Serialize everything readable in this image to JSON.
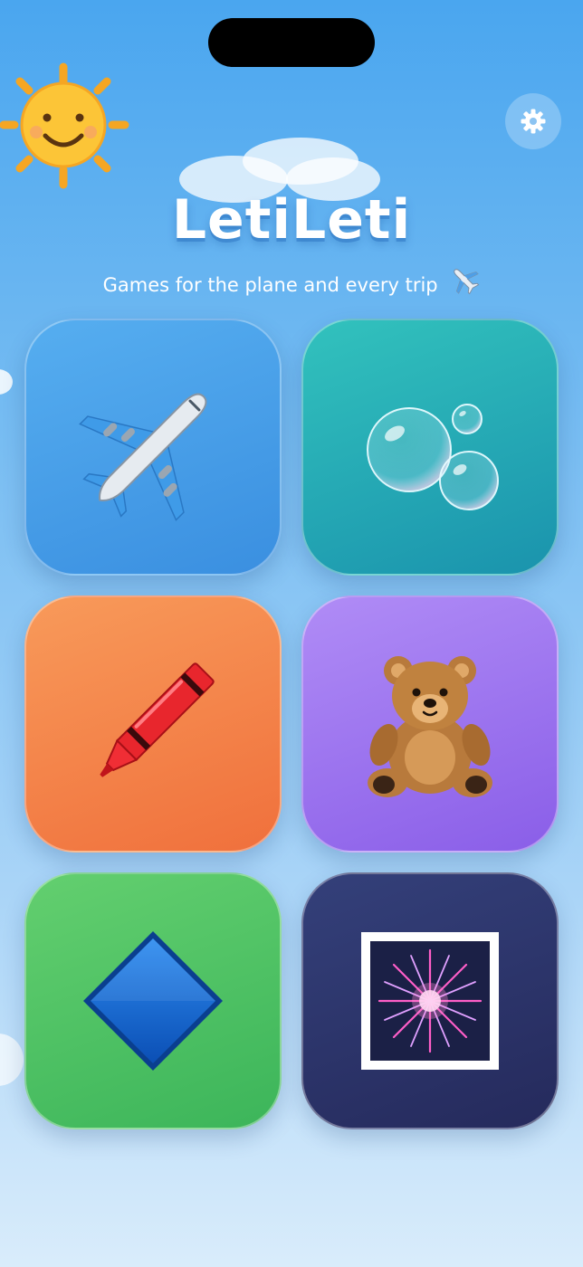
{
  "app": {
    "title": "LetiLeti",
    "subtitle": "Games for the plane and every trip"
  },
  "header": {
    "settings_icon": "gear-icon",
    "sun_icon": "smiling-sun-icon"
  },
  "games": [
    {
      "icon": "airplane-icon",
      "color_top": "#56aef0",
      "color_bottom": "#3a8fe0"
    },
    {
      "icon": "bubbles-icon",
      "color_top": "#32c2bd",
      "color_bottom": "#1a93ad"
    },
    {
      "icon": "crayon-icon",
      "color_top": "#f89a5a",
      "color_bottom": "#f0703c"
    },
    {
      "icon": "teddy-bear-icon",
      "color_top": "#b08cf6",
      "color_bottom": "#8a5ee8"
    },
    {
      "icon": "blue-diamond-icon",
      "color_top": "#63cf6f",
      "color_bottom": "#3cb55a"
    },
    {
      "icon": "fireworks-icon",
      "color_top": "#34407a",
      "color_bottom": "#252a5c"
    }
  ]
}
